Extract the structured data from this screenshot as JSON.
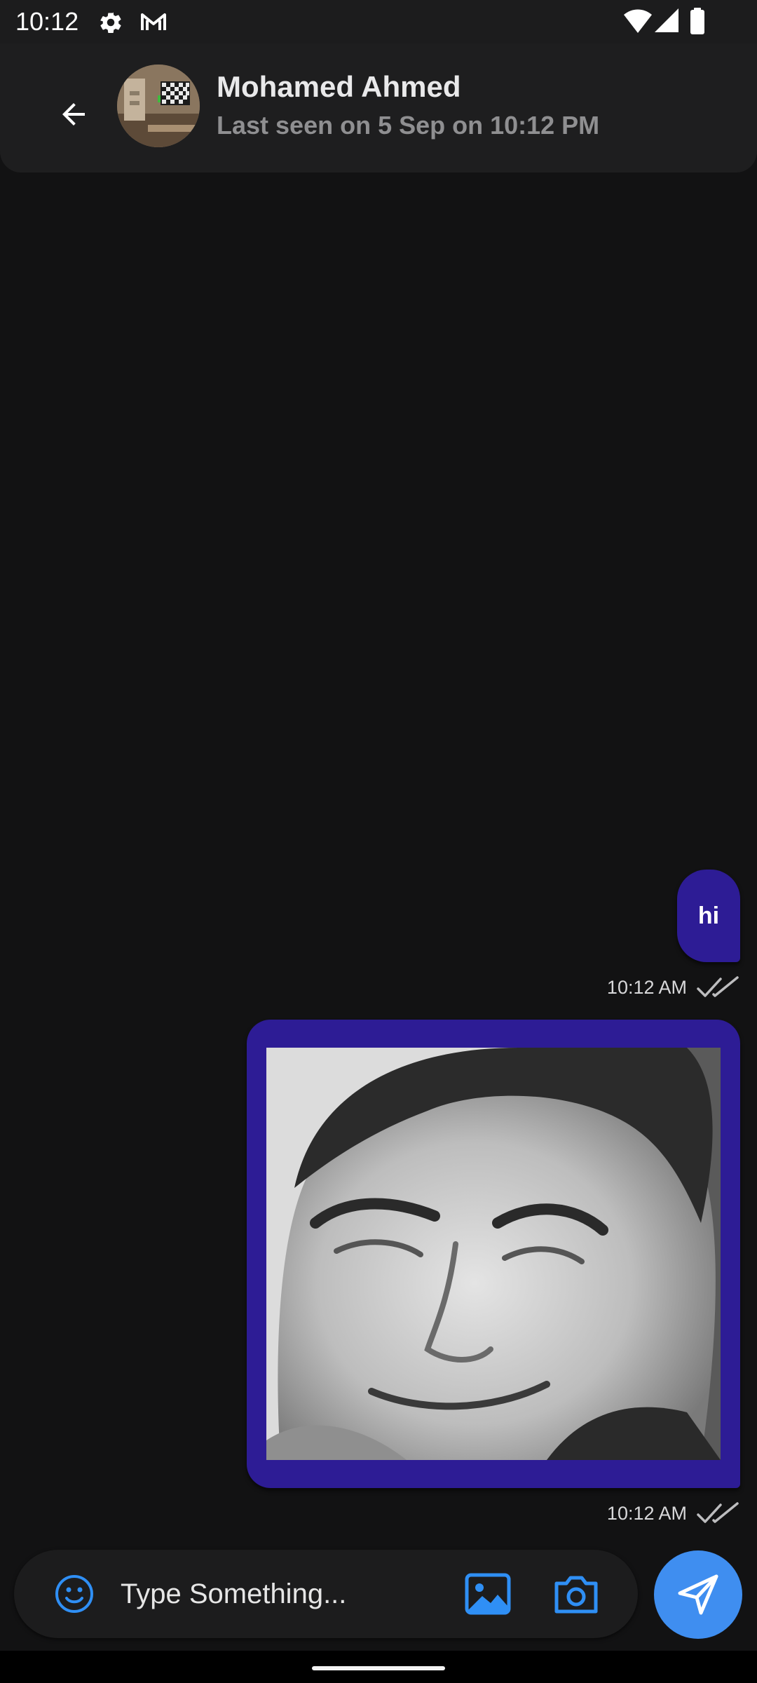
{
  "status_bar": {
    "time": "10:12",
    "icons": [
      "settings-gear-icon",
      "gmail-icon",
      "wifi-icon",
      "signal-icon",
      "battery-icon"
    ]
  },
  "header": {
    "back_icon": "arrow-left-icon",
    "contact_name": "Mohamed Ahmed",
    "last_seen": "Last seen on 5 Sep on 10:12 PM"
  },
  "messages": [
    {
      "type": "text",
      "text": "hi",
      "time": "10:12 AM",
      "status": "double-check-icon"
    },
    {
      "type": "image",
      "time": "10:12 AM",
      "status": "double-check-icon"
    }
  ],
  "input": {
    "placeholder": "Type Something...",
    "value": ""
  },
  "icons": {
    "emoji": "smiley-face-icon",
    "gallery": "image-gallery-icon",
    "camera": "camera-icon",
    "send": "send-paper-plane-icon"
  },
  "colors": {
    "background": "#121213",
    "app_bar": "#1e1e1f",
    "bubble": "#2d1c95",
    "accent": "#3f8ef0",
    "input_icons": "#2f8ff5"
  }
}
